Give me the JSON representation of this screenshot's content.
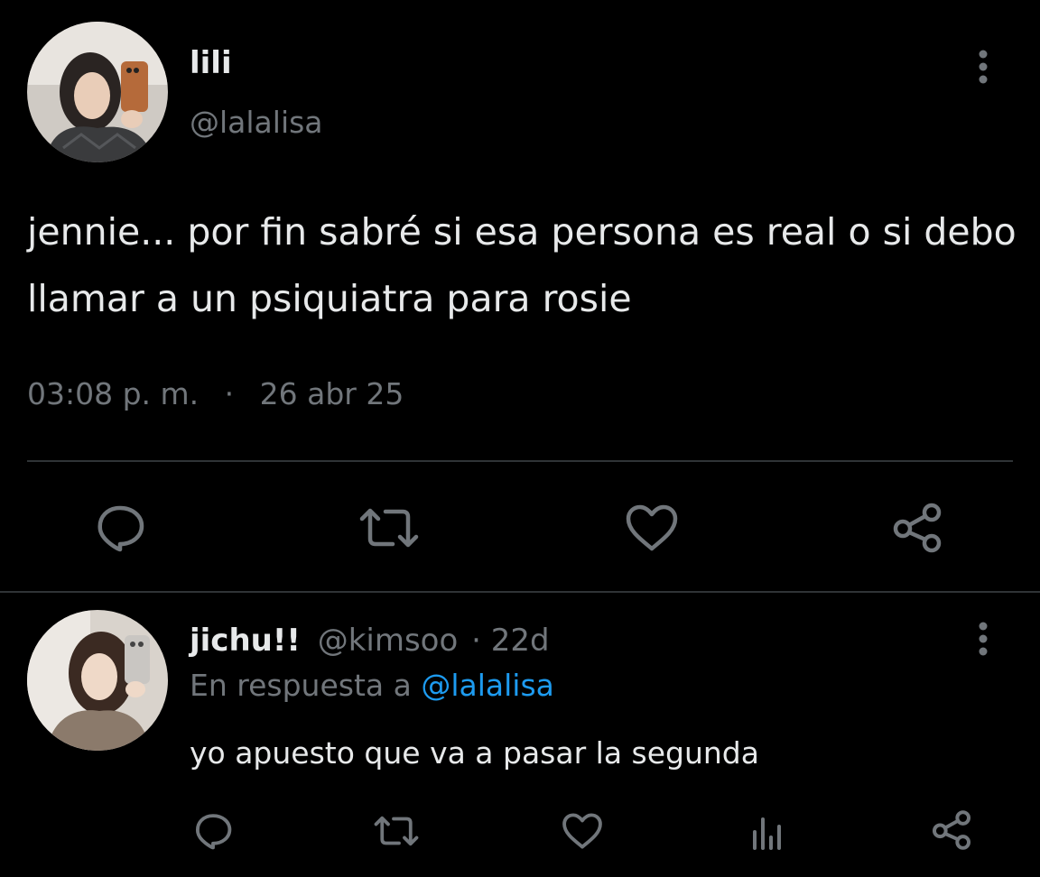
{
  "tweet": {
    "author_name": "lili",
    "author_handle": "@lalalisa",
    "text": "jennie... por fin sabré si esa persona es real o si debo llamar a un psiquiatra para rosie",
    "time": "03:08 p. m.",
    "separator": "·",
    "date": "26 abr 25",
    "actions": [
      "reply-icon",
      "retweet-icon",
      "like-icon",
      "share-icon"
    ]
  },
  "reply": {
    "author_name": "jichu!!",
    "author_handle": "@kimsoo",
    "meta_separator": "·",
    "age": "22d",
    "in_reply_prefix": "En respuesta a",
    "in_reply_handle": "@lalalisa",
    "text": "yo apuesto que va a pasar la segunda",
    "actions": [
      "reply-icon",
      "retweet-icon",
      "like-icon",
      "views-icon",
      "share-icon"
    ]
  },
  "colors": {
    "background": "#000000",
    "text": "#e7e9ea",
    "muted": "#71767b",
    "accent": "#1d9bf0",
    "divider": "#2f3336"
  }
}
